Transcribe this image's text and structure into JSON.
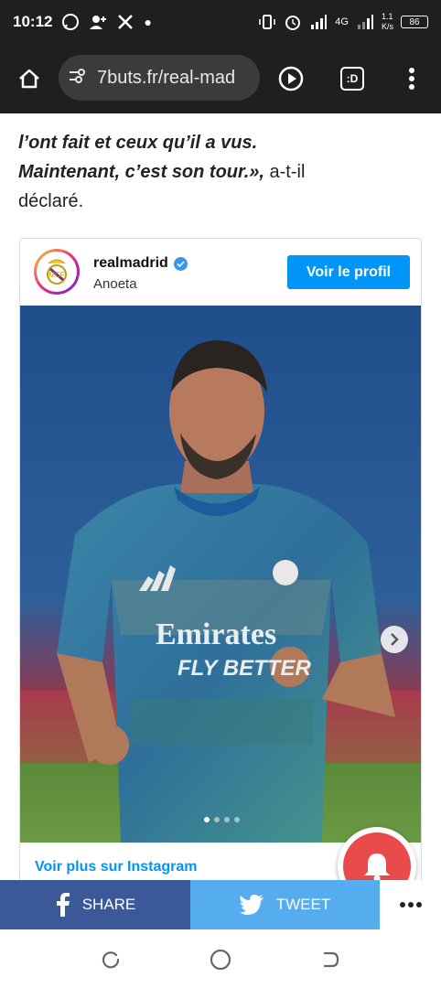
{
  "status_bar": {
    "time": "10:12",
    "network_speed": "1.1\nK/s",
    "network_type": "4G",
    "battery": "86"
  },
  "browser": {
    "url": "7buts.fr/real-mad",
    "tab_label": ":D"
  },
  "article": {
    "quote_line_1": "l’ont fait et ceux qu’il a vus.",
    "quote_line_2": "Maintenant, c’est son tour.»,",
    "attribution": " a-t-il",
    "attribution_line_2": "déclaré."
  },
  "instagram_embed": {
    "account_name": "realmadrid",
    "location": "Anoeta",
    "profile_button_label": "Voir le profil",
    "more_link": "Voir plus sur Instagram",
    "carousel": {
      "total": 4,
      "active": 1
    },
    "photo_jersey_sponsor_line_1": "Emirates",
    "photo_jersey_sponsor_line_2": "FLY BETTER"
  },
  "share_bar": {
    "facebook_label": "SHARE",
    "twitter_label": "TWEET"
  },
  "colors": {
    "facebook": "#3b5998",
    "twitter": "#55acee",
    "instagram_blue": "#0095f6",
    "bell_red": "#e94a4a"
  }
}
